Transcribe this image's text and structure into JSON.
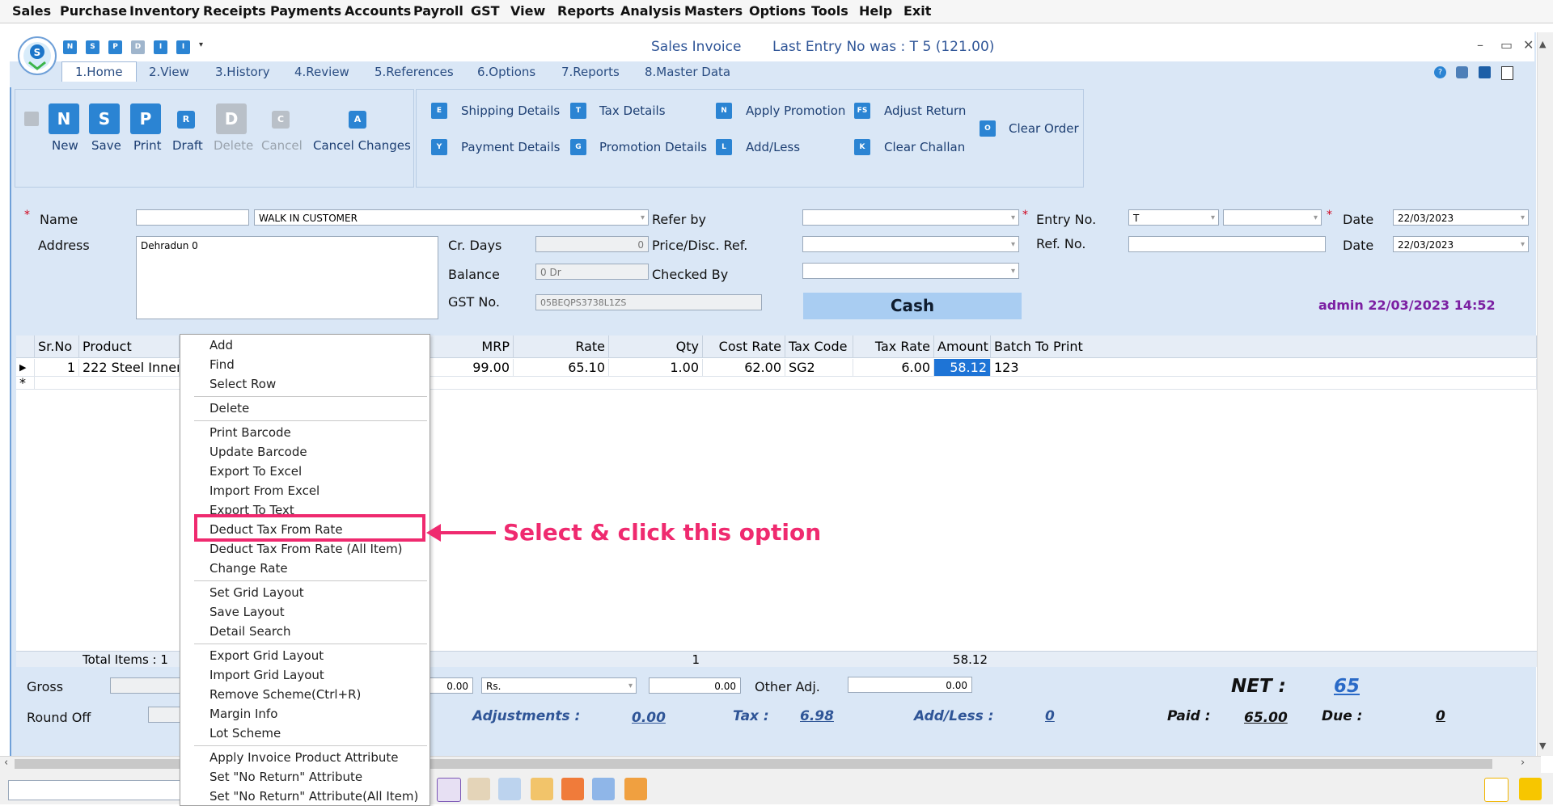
{
  "menubar": [
    "Sales",
    "Purchase",
    "Inventory",
    "Receipts",
    "Payments",
    "Accounts",
    "Payroll",
    "GST",
    "View",
    "Reports",
    "Analysis",
    "Masters",
    "Options",
    "Tools",
    "Help",
    "Exit"
  ],
  "window": {
    "title": "Sales Invoice",
    "last_entry": "Last Entry No was : T 5     (121.00)",
    "quick_access": [
      "N",
      "S",
      "P",
      "D",
      "I",
      "I"
    ]
  },
  "tabs": [
    "1.Home",
    "2.View",
    "3.History",
    "4.Review",
    "5.References",
    "6.Options",
    "7.Reports",
    "8.Master Data"
  ],
  "ribbon": {
    "main_buttons": [
      {
        "label": "New",
        "glyph": "N",
        "enabled": true
      },
      {
        "label": "Save",
        "glyph": "S",
        "enabled": true
      },
      {
        "label": "Print",
        "glyph": "P",
        "enabled": true
      },
      {
        "label": "Draft",
        "glyph": "R",
        "enabled": true
      },
      {
        "label": "Delete",
        "glyph": "D",
        "enabled": false
      },
      {
        "label": "Cancel",
        "glyph": "C",
        "enabled": false
      },
      {
        "label": "Cancel Changes",
        "glyph": "A",
        "enabled": true
      }
    ],
    "actions": {
      "shipping_details": "Shipping Details",
      "payment_details": "Payment Details",
      "tax_details": "Tax Details",
      "promotion_details": "Promotion Details",
      "apply_promotion": "Apply Promotion",
      "add_less": "Add/Less",
      "adjust_return": "Adjust Return",
      "clear_challan": "Clear Challan",
      "clear_order": "Clear Order"
    },
    "action_glyphs": {
      "shipping_details": "E",
      "payment_details": "Y",
      "tax_details": "T",
      "promotion_details": "G",
      "apply_promotion": "N",
      "add_less": "L",
      "adjust_return": "FS",
      "clear_challan": "K",
      "clear_order": "O"
    }
  },
  "form": {
    "name_label": "Name",
    "name_value": "",
    "customer": "WALK IN CUSTOMER",
    "address_label": "Address",
    "address": "Dehradun 0",
    "cr_days_label": "Cr. Days",
    "cr_days": "0",
    "balance_label": "Balance",
    "balance": "0 Dr",
    "gst_label": "GST No.",
    "gst": "05BEQPS3738L1ZS",
    "refer_by_label": "Refer by",
    "price_disc_label": "Price/Disc. Ref.",
    "checked_by_label": "Checked By",
    "payment_mode": "Cash",
    "entry_no_label": "Entry No.",
    "entry_no": "T",
    "ref_no_label": "Ref. No.",
    "date_label": "Date",
    "date1": "22/03/2023",
    "date2": "22/03/2023",
    "user_stamp": "admin 22/03/2023 14:52"
  },
  "grid": {
    "headers": {
      "srno": "Sr.No",
      "product": "Product",
      "mrp": "MRP",
      "rate": "Rate",
      "qty": "Qty",
      "cost_rate": "Cost Rate",
      "tax_code": "Tax Code",
      "tax_rate": "Tax Rate",
      "amount": "Amount",
      "batch": "Batch To Print"
    },
    "row": {
      "srno": "1",
      "product": "222 Steel Inner I",
      "mrp": "99.00",
      "rate": "65.10",
      "qty": "1.00",
      "cost_rate": "62.00",
      "tax_code": "SG2",
      "tax_rate": "6.00",
      "amount": "58.12",
      "batch": "123"
    },
    "footer": {
      "total_items": "Total Items : 1",
      "qty_total": "1",
      "amount_total": "58.12"
    }
  },
  "totals": {
    "gross_label": "Gross",
    "round_off_label": "Round Off",
    "field1": "0.00",
    "currency": "Rs.",
    "field2": "0.00",
    "other_adj_label": "Other Adj.",
    "other_adj": "0.00",
    "adjustments_label": "Adjustments :",
    "adjustments": "0.00",
    "tax_label": "Tax :",
    "tax": "6.98",
    "addless_label": "Add/Less :",
    "addless": "0",
    "net_label": "NET :",
    "net": "65",
    "paid_label": "Paid :",
    "paid": "65.00",
    "due_label": "Due :",
    "due": "0"
  },
  "context_menu": {
    "items": [
      "Add",
      "Find",
      "Select Row",
      "Delete",
      "Print Barcode",
      "Update Barcode",
      "Export To Excel",
      "Import From Excel",
      "Export To Text",
      "Deduct Tax From Rate",
      "Deduct Tax From Rate (All Item)",
      "Change Rate",
      "Set Grid Layout",
      "Save Layout",
      "Detail Search",
      "Export Grid Layout",
      "Import Grid Layout",
      "Remove Scheme(Ctrl+R)",
      "Margin Info",
      "Lot Scheme",
      "Apply Invoice Product Attribute",
      "Set \"No Return\" Attribute",
      "Set \"No Return\" Attribute(All Item)"
    ],
    "highlighted": "Deduct Tax From Rate"
  },
  "annotation": "Select & click this option",
  "colors": {
    "accent": "#2b84d3",
    "panel": "#dae7f6",
    "callout": "#ef2a6f",
    "title_blue": "#2f5597",
    "user_stamp": "#7b1fa2",
    "selected_cell": "#1e74d6"
  }
}
